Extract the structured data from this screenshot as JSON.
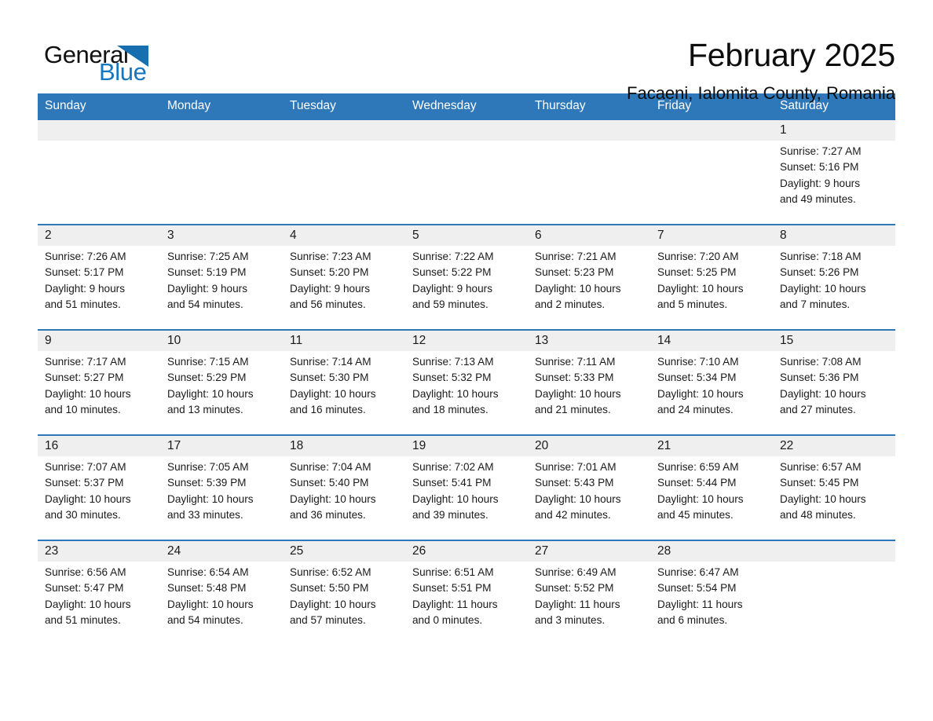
{
  "brand": {
    "name_part1": "General",
    "name_part2": "Blue",
    "triangle_color": "#176fb0",
    "accent_color": "#2e77b8"
  },
  "header": {
    "title": "February 2025",
    "location": "Facaeni, Ialomita County, Romania"
  },
  "calendar": {
    "weekday_headers": [
      "Sunday",
      "Monday",
      "Tuesday",
      "Wednesday",
      "Thursday",
      "Friday",
      "Saturday"
    ],
    "weeks": [
      [
        {
          "day": "",
          "sunrise": "",
          "sunset": "",
          "daylight_line1": "",
          "daylight_line2": ""
        },
        {
          "day": "",
          "sunrise": "",
          "sunset": "",
          "daylight_line1": "",
          "daylight_line2": ""
        },
        {
          "day": "",
          "sunrise": "",
          "sunset": "",
          "daylight_line1": "",
          "daylight_line2": ""
        },
        {
          "day": "",
          "sunrise": "",
          "sunset": "",
          "daylight_line1": "",
          "daylight_line2": ""
        },
        {
          "day": "",
          "sunrise": "",
          "sunset": "",
          "daylight_line1": "",
          "daylight_line2": ""
        },
        {
          "day": "",
          "sunrise": "",
          "sunset": "",
          "daylight_line1": "",
          "daylight_line2": ""
        },
        {
          "day": "1",
          "sunrise": "Sunrise: 7:27 AM",
          "sunset": "Sunset: 5:16 PM",
          "daylight_line1": "Daylight: 9 hours",
          "daylight_line2": "and 49 minutes."
        }
      ],
      [
        {
          "day": "2",
          "sunrise": "Sunrise: 7:26 AM",
          "sunset": "Sunset: 5:17 PM",
          "daylight_line1": "Daylight: 9 hours",
          "daylight_line2": "and 51 minutes."
        },
        {
          "day": "3",
          "sunrise": "Sunrise: 7:25 AM",
          "sunset": "Sunset: 5:19 PM",
          "daylight_line1": "Daylight: 9 hours",
          "daylight_line2": "and 54 minutes."
        },
        {
          "day": "4",
          "sunrise": "Sunrise: 7:23 AM",
          "sunset": "Sunset: 5:20 PM",
          "daylight_line1": "Daylight: 9 hours",
          "daylight_line2": "and 56 minutes."
        },
        {
          "day": "5",
          "sunrise": "Sunrise: 7:22 AM",
          "sunset": "Sunset: 5:22 PM",
          "daylight_line1": "Daylight: 9 hours",
          "daylight_line2": "and 59 minutes."
        },
        {
          "day": "6",
          "sunrise": "Sunrise: 7:21 AM",
          "sunset": "Sunset: 5:23 PM",
          "daylight_line1": "Daylight: 10 hours",
          "daylight_line2": "and 2 minutes."
        },
        {
          "day": "7",
          "sunrise": "Sunrise: 7:20 AM",
          "sunset": "Sunset: 5:25 PM",
          "daylight_line1": "Daylight: 10 hours",
          "daylight_line2": "and 5 minutes."
        },
        {
          "day": "8",
          "sunrise": "Sunrise: 7:18 AM",
          "sunset": "Sunset: 5:26 PM",
          "daylight_line1": "Daylight: 10 hours",
          "daylight_line2": "and 7 minutes."
        }
      ],
      [
        {
          "day": "9",
          "sunrise": "Sunrise: 7:17 AM",
          "sunset": "Sunset: 5:27 PM",
          "daylight_line1": "Daylight: 10 hours",
          "daylight_line2": "and 10 minutes."
        },
        {
          "day": "10",
          "sunrise": "Sunrise: 7:15 AM",
          "sunset": "Sunset: 5:29 PM",
          "daylight_line1": "Daylight: 10 hours",
          "daylight_line2": "and 13 minutes."
        },
        {
          "day": "11",
          "sunrise": "Sunrise: 7:14 AM",
          "sunset": "Sunset: 5:30 PM",
          "daylight_line1": "Daylight: 10 hours",
          "daylight_line2": "and 16 minutes."
        },
        {
          "day": "12",
          "sunrise": "Sunrise: 7:13 AM",
          "sunset": "Sunset: 5:32 PM",
          "daylight_line1": "Daylight: 10 hours",
          "daylight_line2": "and 18 minutes."
        },
        {
          "day": "13",
          "sunrise": "Sunrise: 7:11 AM",
          "sunset": "Sunset: 5:33 PM",
          "daylight_line1": "Daylight: 10 hours",
          "daylight_line2": "and 21 minutes."
        },
        {
          "day": "14",
          "sunrise": "Sunrise: 7:10 AM",
          "sunset": "Sunset: 5:34 PM",
          "daylight_line1": "Daylight: 10 hours",
          "daylight_line2": "and 24 minutes."
        },
        {
          "day": "15",
          "sunrise": "Sunrise: 7:08 AM",
          "sunset": "Sunset: 5:36 PM",
          "daylight_line1": "Daylight: 10 hours",
          "daylight_line2": "and 27 minutes."
        }
      ],
      [
        {
          "day": "16",
          "sunrise": "Sunrise: 7:07 AM",
          "sunset": "Sunset: 5:37 PM",
          "daylight_line1": "Daylight: 10 hours",
          "daylight_line2": "and 30 minutes."
        },
        {
          "day": "17",
          "sunrise": "Sunrise: 7:05 AM",
          "sunset": "Sunset: 5:39 PM",
          "daylight_line1": "Daylight: 10 hours",
          "daylight_line2": "and 33 minutes."
        },
        {
          "day": "18",
          "sunrise": "Sunrise: 7:04 AM",
          "sunset": "Sunset: 5:40 PM",
          "daylight_line1": "Daylight: 10 hours",
          "daylight_line2": "and 36 minutes."
        },
        {
          "day": "19",
          "sunrise": "Sunrise: 7:02 AM",
          "sunset": "Sunset: 5:41 PM",
          "daylight_line1": "Daylight: 10 hours",
          "daylight_line2": "and 39 minutes."
        },
        {
          "day": "20",
          "sunrise": "Sunrise: 7:01 AM",
          "sunset": "Sunset: 5:43 PM",
          "daylight_line1": "Daylight: 10 hours",
          "daylight_line2": "and 42 minutes."
        },
        {
          "day": "21",
          "sunrise": "Sunrise: 6:59 AM",
          "sunset": "Sunset: 5:44 PM",
          "daylight_line1": "Daylight: 10 hours",
          "daylight_line2": "and 45 minutes."
        },
        {
          "day": "22",
          "sunrise": "Sunrise: 6:57 AM",
          "sunset": "Sunset: 5:45 PM",
          "daylight_line1": "Daylight: 10 hours",
          "daylight_line2": "and 48 minutes."
        }
      ],
      [
        {
          "day": "23",
          "sunrise": "Sunrise: 6:56 AM",
          "sunset": "Sunset: 5:47 PM",
          "daylight_line1": "Daylight: 10 hours",
          "daylight_line2": "and 51 minutes."
        },
        {
          "day": "24",
          "sunrise": "Sunrise: 6:54 AM",
          "sunset": "Sunset: 5:48 PM",
          "daylight_line1": "Daylight: 10 hours",
          "daylight_line2": "and 54 minutes."
        },
        {
          "day": "25",
          "sunrise": "Sunrise: 6:52 AM",
          "sunset": "Sunset: 5:50 PM",
          "daylight_line1": "Daylight: 10 hours",
          "daylight_line2": "and 57 minutes."
        },
        {
          "day": "26",
          "sunrise": "Sunrise: 6:51 AM",
          "sunset": "Sunset: 5:51 PM",
          "daylight_line1": "Daylight: 11 hours",
          "daylight_line2": "and 0 minutes."
        },
        {
          "day": "27",
          "sunrise": "Sunrise: 6:49 AM",
          "sunset": "Sunset: 5:52 PM",
          "daylight_line1": "Daylight: 11 hours",
          "daylight_line2": "and 3 minutes."
        },
        {
          "day": "28",
          "sunrise": "Sunrise: 6:47 AM",
          "sunset": "Sunset: 5:54 PM",
          "daylight_line1": "Daylight: 11 hours",
          "daylight_line2": "and 6 minutes."
        },
        {
          "day": "",
          "sunrise": "",
          "sunset": "",
          "daylight_line1": "",
          "daylight_line2": ""
        }
      ]
    ]
  }
}
